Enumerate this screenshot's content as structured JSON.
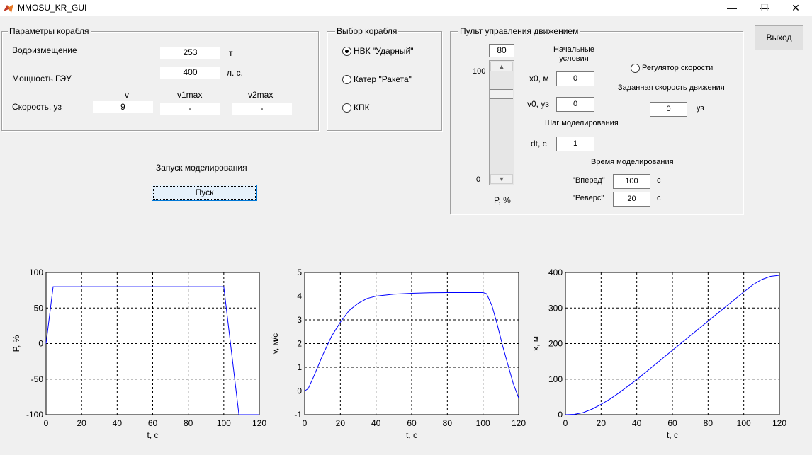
{
  "window": {
    "title": "MMOSU_KR_GUI",
    "minimize": "—",
    "maximize": "☐",
    "close": "✕"
  },
  "ship_params": {
    "title": "Параметры корабля",
    "displacement_label": "Водоизмещение",
    "displacement_value": "253",
    "displacement_unit": "т",
    "power_label": "Мощность ГЭУ",
    "power_value": "400",
    "power_unit": "л. с.",
    "speed_label": "Скорость, уз",
    "col_v": "v",
    "col_v1max": "v1max",
    "col_v2max": "v2max",
    "v_value": "9",
    "v1max_value": "-",
    "v2max_value": "-"
  },
  "ship_select": {
    "title": "Выбор корабля",
    "options": [
      {
        "label": "НВК \"Ударный\"",
        "checked": true
      },
      {
        "label": "Катер \"Ракета\"",
        "checked": false
      },
      {
        "label": "КПК",
        "checked": false
      }
    ]
  },
  "motion_control": {
    "title": "Пульт управления движением",
    "power_value": "80",
    "slider_max": "100",
    "slider_min": "0",
    "power_label": "P, %",
    "slider_level": 0.8,
    "initial_conditions": "Начальные\nусловия",
    "x0_label": "x0, м",
    "x0_value": "0",
    "v0_label": "v0, уз",
    "v0_value": "0",
    "step_title": "Шаг моделирования",
    "dt_label": "dt, с",
    "dt_value": "1",
    "sim_time_title": "Время моделирования",
    "forward_label": "\"Вперед\"",
    "forward_value": "100",
    "forward_unit": "с",
    "reverse_label": "\"Реверс\"",
    "reverse_value": "20",
    "reverse_unit": "с",
    "regulator_label": "Регулятор скорости",
    "target_speed_title": "Заданная скорость движения",
    "target_speed_value": "0",
    "target_speed_unit": "уз"
  },
  "exit_button": "Выход",
  "run": {
    "label": "Запуск моделирования",
    "button": "Пуск"
  },
  "chart_data": [
    {
      "type": "line",
      "xlabel": "t, с",
      "ylabel": "P, %",
      "xlim": [
        0,
        120
      ],
      "ylim": [
        -100,
        100
      ],
      "xticks": [
        0,
        20,
        40,
        60,
        80,
        100,
        120
      ],
      "yticks": [
        -100,
        -50,
        0,
        50,
        100
      ],
      "grid": true,
      "series": [
        {
          "color": "#0000ff",
          "x": [
            0,
            4,
            100,
            108.5,
            120
          ],
          "y": [
            0,
            80,
            80,
            -100,
            -100
          ]
        }
      ]
    },
    {
      "type": "line",
      "xlabel": "t, с",
      "ylabel": "v, м/с",
      "xlim": [
        0,
        120
      ],
      "ylim": [
        -1,
        5
      ],
      "xticks": [
        0,
        20,
        40,
        60,
        80,
        100,
        120
      ],
      "yticks": [
        -1,
        0,
        1,
        2,
        3,
        4,
        5
      ],
      "grid": true,
      "series": [
        {
          "color": "#0000ff",
          "x": [
            0,
            2,
            5,
            10,
            15,
            20,
            25,
            30,
            35,
            40,
            50,
            60,
            70,
            80,
            90,
            100,
            102,
            105,
            108,
            111,
            114,
            117,
            120
          ],
          "y": [
            0,
            0.1,
            0.6,
            1.5,
            2.3,
            2.9,
            3.4,
            3.7,
            3.9,
            4.0,
            4.08,
            4.12,
            4.14,
            4.15,
            4.15,
            4.15,
            4.1,
            3.6,
            2.8,
            1.9,
            1.1,
            0.3,
            -0.3
          ]
        }
      ]
    },
    {
      "type": "line",
      "xlabel": "t, с",
      "ylabel": "x, м",
      "xlim": [
        0,
        120
      ],
      "ylim": [
        0,
        400
      ],
      "xticks": [
        0,
        20,
        40,
        60,
        80,
        100,
        120
      ],
      "yticks": [
        0,
        100,
        200,
        300,
        400
      ],
      "grid": true,
      "series": [
        {
          "color": "#0000ff",
          "x": [
            0,
            5,
            10,
            15,
            20,
            25,
            30,
            35,
            40,
            50,
            60,
            70,
            80,
            90,
            100,
            105,
            110,
            115,
            120
          ],
          "y": [
            0,
            1,
            6,
            16,
            29,
            44,
            61,
            80,
            99,
            140,
            181,
            222,
            263,
            304,
            345,
            365,
            380,
            389,
            392
          ]
        }
      ]
    }
  ]
}
